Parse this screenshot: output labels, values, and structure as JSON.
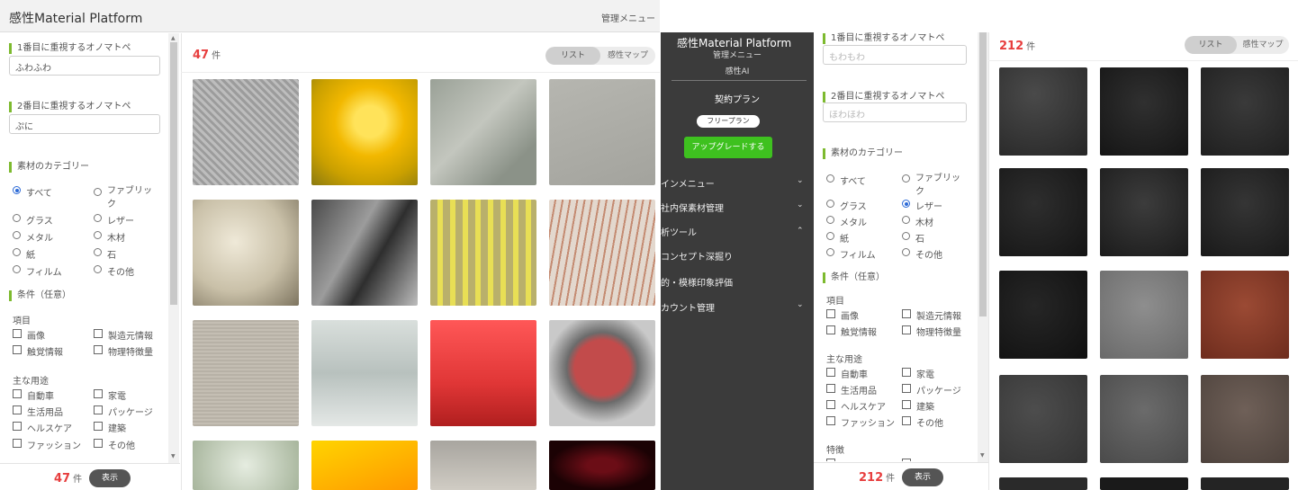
{
  "left": {
    "header": {
      "title": "感性Material Platform",
      "admin": "管理メニュー"
    },
    "filters": {
      "first_label": "1番目に重視するオノマトペ",
      "first_value": "ふわふわ",
      "second_label": "2番目に重視するオノマトペ",
      "second_value": "ぷに",
      "category_label": "素材のカテゴリー",
      "categories": [
        "すべて",
        "ファブリック",
        "グラス",
        "レザー",
        "メタル",
        "木材",
        "紙",
        "石",
        "フィルム",
        "その他"
      ],
      "selected_category": "すべて",
      "conditions_label": "条件（任意）",
      "item_label": "項目",
      "items": [
        "画像",
        "製造元情報",
        "触覚情報",
        "物理特徴量"
      ],
      "usage_label": "主な用途",
      "usages": [
        "自動車",
        "家電",
        "生活用品",
        "パッケージ",
        "ヘルスケア",
        "建築",
        "ファッション",
        "その他"
      ]
    },
    "footer": {
      "count": "47",
      "unit": "件",
      "show": "表示"
    },
    "results": {
      "count": "47",
      "unit": "件",
      "toggle_list": "リスト",
      "toggle_map": "感性マップ"
    },
    "tiles": [
      "knit-fabric",
      "yellow-resin",
      "leaf",
      "grey-felt",
      "rope-fibers",
      "metal-foil",
      "yellow-mesh",
      "clear-tubes",
      "canvas",
      "frosted-glass",
      "red-plastic",
      "red-stone",
      "cactus",
      "orange-gel",
      "grey-blur",
      "dark-red-mesh"
    ]
  },
  "right": {
    "menu": {
      "title": "感性Material Platform",
      "admin": "管理メニュー",
      "ai": "感性AI",
      "plan_label": "契約プラン",
      "plan_button": "フリープラン",
      "upgrade": "アップグレードする",
      "items": [
        "インメニュー",
        "社内保素材管理",
        "析ツール",
        "コンセプト深掘り",
        "的・模様印象評価",
        "カウント管理"
      ]
    },
    "filters": {
      "first_label": "1番目に重視するオノマトペ",
      "first_placeholder": "もわもわ",
      "second_label": "2番目に重視するオノマトペ",
      "second_placeholder": "ほわほわ",
      "category_label": "素材のカテゴリー",
      "categories": [
        "すべて",
        "ファブリック",
        "グラス",
        "レザー",
        "メタル",
        "木材",
        "紙",
        "石",
        "フィルム",
        "その他"
      ],
      "selected_category": "レザー",
      "conditions_label": "条件（任意）",
      "item_label": "項目",
      "items": [
        "画像",
        "製造元情報",
        "触覚情報",
        "物理特徴量"
      ],
      "usage_label": "主な用途",
      "usages": [
        "自動車",
        "家電",
        "生活用品",
        "パッケージ",
        "ヘルスケア",
        "建築",
        "ファッション",
        "その他"
      ],
      "feature_label": "特徴"
    },
    "footer": {
      "count": "212",
      "unit": "件",
      "show": "表示"
    },
    "results": {
      "count": "212",
      "unit": "件",
      "toggle_list": "リスト",
      "toggle_map": "感性マップ"
    },
    "tiles": [
      "dark-leather",
      "black-leather",
      "charcoal-leather",
      "black-leather",
      "dark-leather",
      "charcoal-leather",
      "black-leather",
      "grey-leather",
      "brown-leather",
      "dark-grey-leather",
      "grey-leather",
      "taupe-leather"
    ]
  }
}
